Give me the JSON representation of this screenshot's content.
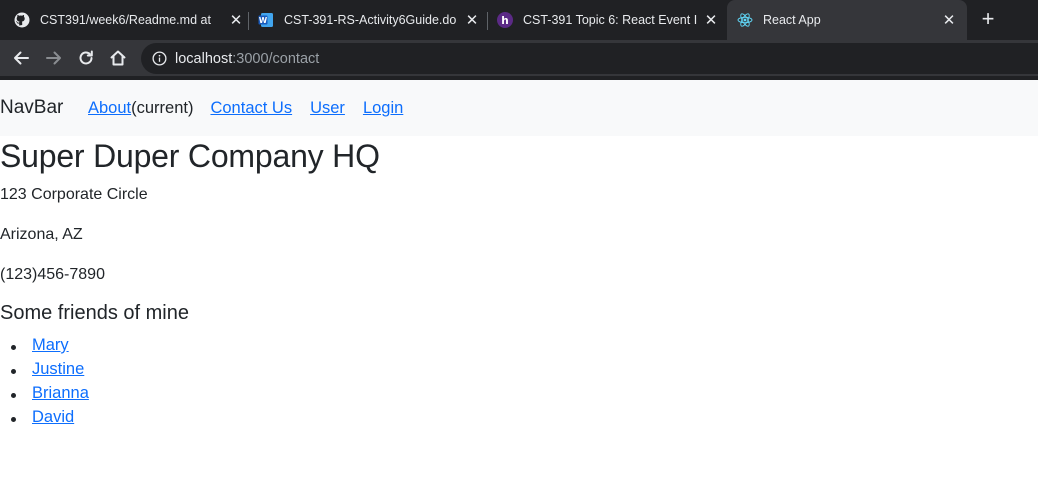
{
  "browser": {
    "tabs": [
      {
        "title": "CST391/week6/Readme.md at",
        "icon": "github-icon",
        "active": false
      },
      {
        "title": "CST-391-RS-Activity6Guide.do",
        "icon": "word-icon",
        "active": false
      },
      {
        "title": "CST-391 Topic 6: React Event I",
        "icon": "halo-icon",
        "active": false
      },
      {
        "title": "React App",
        "icon": "react-icon",
        "active": true
      }
    ],
    "new_tab_label": "+",
    "close_glyph": "✕",
    "url_host": "localhost",
    "url_path": ":3000/contact"
  },
  "navbar": {
    "brand": "NavBar",
    "about": "About",
    "current": "(current)",
    "contact": "Contact Us",
    "user": "User",
    "login": "Login"
  },
  "content": {
    "title": "Super Duper Company HQ",
    "address_line1": "123 Corporate Circle",
    "address_line2": "Arizona, AZ",
    "phone": "(123)456-7890",
    "friends_heading": "Some friends of mine",
    "friends": [
      "Mary",
      "Justine",
      "Brianna",
      "David"
    ]
  },
  "colors": {
    "link": "#0d6efd",
    "navbar_bg": "#f8f9fa",
    "text": "#212529",
    "chrome_dark": "#202124",
    "chrome_tab": "#35363a"
  }
}
